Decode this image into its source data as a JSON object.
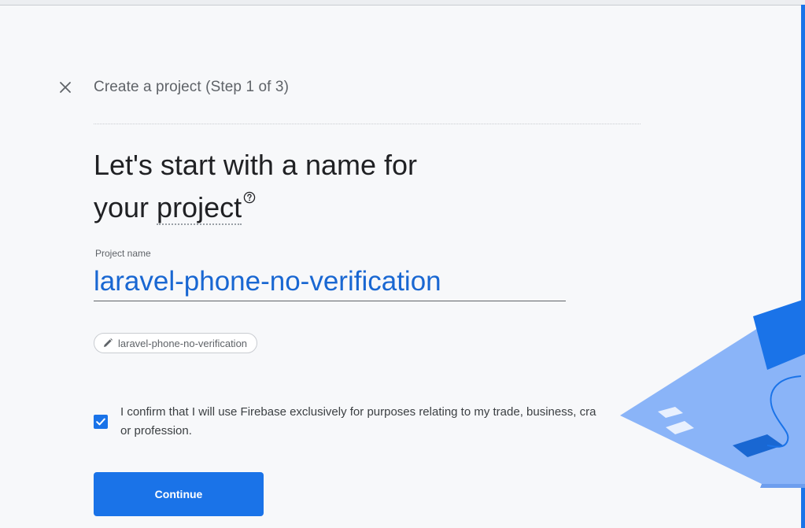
{
  "dialog": {
    "step_title": "Create a project (Step 1 of 3)",
    "headline_line1": "Let's start with a name for",
    "headline_your": "your ",
    "headline_term": "project",
    "help_icon": "help-circle-icon",
    "close_icon": "close-icon"
  },
  "form": {
    "project_name_label": "Project name",
    "project_name_value": "laravel-phone-no-verification",
    "project_id_chip": "laravel-phone-no-verification",
    "edit_icon": "pencil-icon",
    "confirm_line1": "I confirm that I will use Firebase exclusively for purposes relating to my trade, business, cra",
    "confirm_line2": "or profession.",
    "confirm_checked": true,
    "continue_label": "Continue"
  },
  "colors": {
    "accent": "#1a73e8",
    "input_text": "#1967d2",
    "background": "#f7f8fa"
  }
}
